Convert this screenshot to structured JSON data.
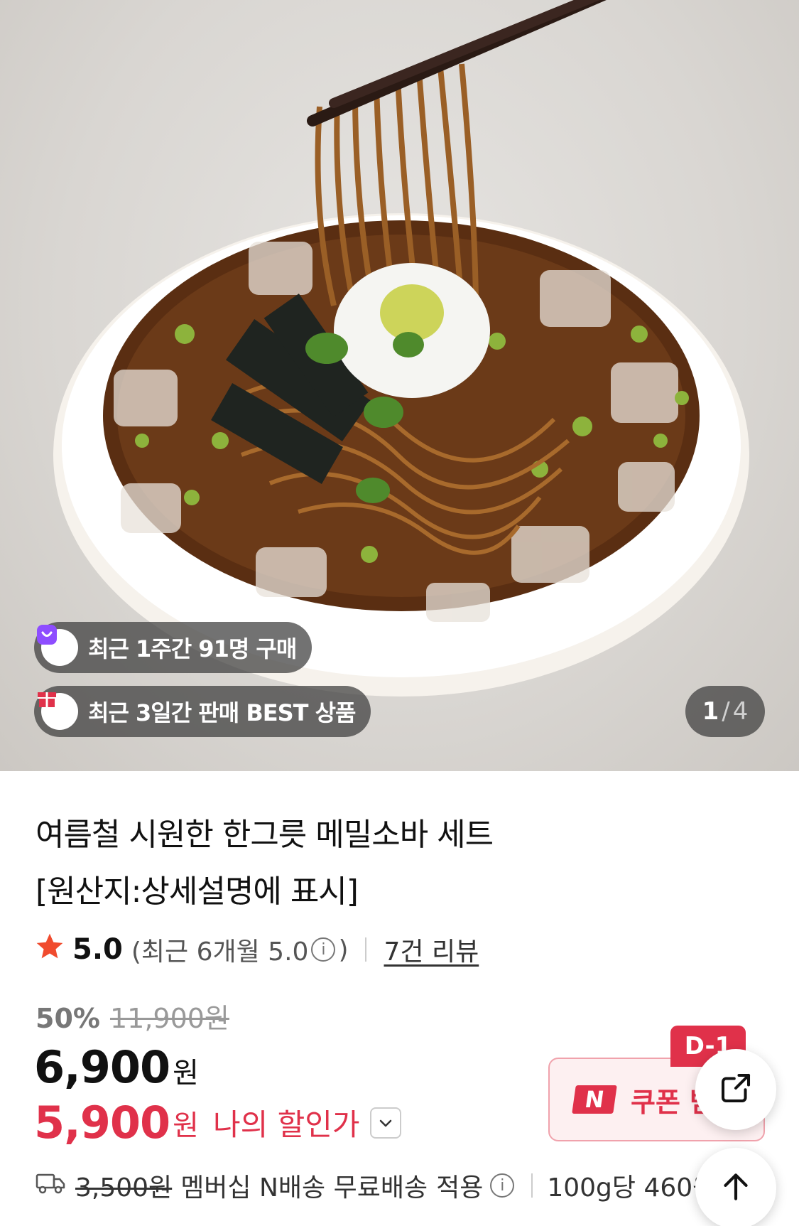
{
  "badges": {
    "recent_buyers": "최근 1주간 91명 구매",
    "best_seller": "최근 3일간 판매 BEST 상품"
  },
  "gallery": {
    "current": "1",
    "separator": "/",
    "total": "4"
  },
  "product": {
    "title_line1": "여름철 시원한 한그릇 메밀소바 세트",
    "title_line2": "[원산지:상세설명에 표시]"
  },
  "rating": {
    "score": "5.0",
    "recent_prefix": "(최근 6개월 5.0",
    "recent_suffix": ")",
    "review_link": "7건 리뷰"
  },
  "price": {
    "discount_percent": "50%",
    "original_price": "11,900원",
    "sale_price": "6,900",
    "currency": "원",
    "my_price": "5,900",
    "my_price_label": "나의 할인가"
  },
  "coupon": {
    "dday": "D-1",
    "logo": "N",
    "label": "쿠폰 받기"
  },
  "shipping": {
    "original_fee": "3,500원",
    "text": "멤버십 N배송 무료배송",
    "apply": "적용",
    "unit_price": "100g당 460원"
  },
  "icons": {
    "buyers_badge_icon": "shopping-bag-icon",
    "best_badge_icon": "gift-box-icon",
    "star": "star-icon",
    "info": "info-icon",
    "chevron": "chevron-down-icon",
    "truck": "truck-icon",
    "share": "share-icon",
    "scroll_top": "arrow-up-icon"
  },
  "colors": {
    "accent_red": "#e0314a",
    "star_orange": "#f04b2e",
    "badge_purple": "#8e4dff"
  }
}
